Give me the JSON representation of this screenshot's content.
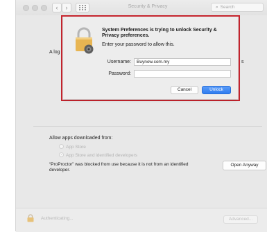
{
  "window": {
    "title": "Security & Privacy",
    "nav_back": "‹",
    "nav_forward": "›",
    "grid_icon": "grid-icon",
    "search_placeholder": "Search"
  },
  "background": {
    "partial_text_left": "A log",
    "partial_text_right": "s"
  },
  "section": {
    "label": "Allow apps downloaded from:",
    "options": [
      {
        "label": "App Store",
        "selected": false
      },
      {
        "label": "App Store and identified developers",
        "selected": true
      }
    ],
    "blocked_message": "“ProProctor” was blocked from use because it is not from an identified developer.",
    "open_anyway_label": "Open Anyway"
  },
  "bottom": {
    "status": "Authenticating...",
    "advanced_label": "Advanced..."
  },
  "dialog": {
    "title": "System Preferences is trying to unlock Security & Privacy preferences.",
    "subtitle": "Enter your password to allow this.",
    "username_label": "Username:",
    "username_value": "Buynow.com.my",
    "password_label": "Password:",
    "password_value": "",
    "cancel_label": "Cancel",
    "unlock_label": "Unlock",
    "highlight_color": "#c8242e",
    "accent_color": "#2f7cf0"
  }
}
